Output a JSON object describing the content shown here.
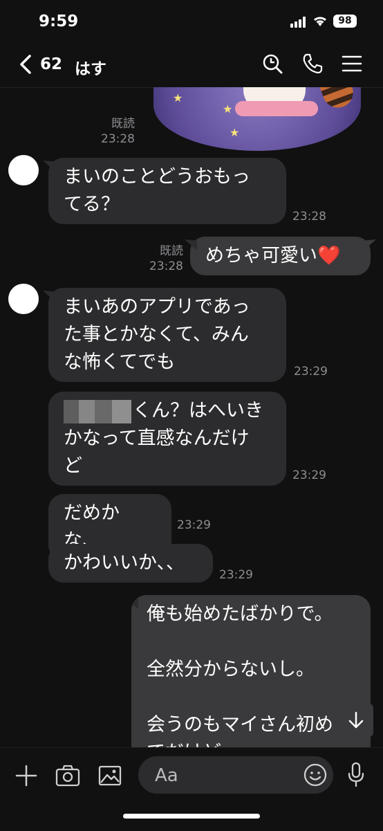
{
  "status": {
    "time": "9:59",
    "battery": "98"
  },
  "header": {
    "count": "62",
    "title": "はす"
  },
  "messages": [
    {
      "read": "既読",
      "time": "23:28"
    },
    {
      "text": "まいのことどうおもっ\nてる？",
      "time": "23:28"
    },
    {
      "read": "既読",
      "time": "23:28",
      "text": "めちゃ可愛い",
      "emoji": "❤️"
    },
    {
      "text": "まいあのアプリであっ\nた事とかなくて、みん\nな怖くてでも",
      "time": "23:29"
    },
    {
      "text": "くん？はへいき\nかなって直感なんだけ\nど",
      "time": "23:29"
    },
    {
      "text": "だめかな、",
      "time": "23:29"
    },
    {
      "text": "かわいいか、、",
      "time": "23:29"
    },
    {
      "text": "俺も始めたばかりで。\n\n全然分からないし。\n\n会うのもマイさん初め\nてだけど"
    }
  ],
  "input": {
    "placeholder": "Aa"
  },
  "icons": [
    "chevron-left-icon",
    "search-icon",
    "phone-icon",
    "menu-icon",
    "plus-icon",
    "camera-icon",
    "image-icon",
    "emoji-icon",
    "mic-icon",
    "arrow-down-icon"
  ]
}
